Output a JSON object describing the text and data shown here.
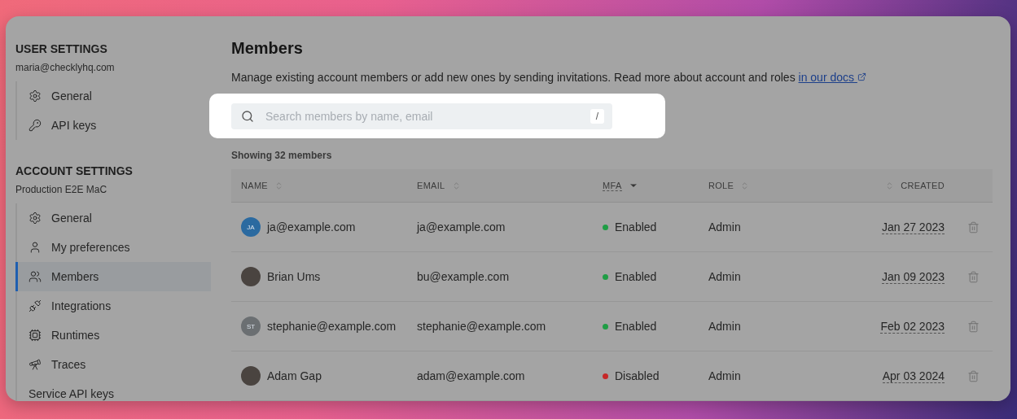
{
  "sidebar": {
    "sections": [
      {
        "title": "USER SETTINGS",
        "subtitle": "maria@checklyhq.com",
        "items": [
          {
            "label": "General",
            "kind": "gear",
            "selected": false
          },
          {
            "label": "API keys",
            "kind": "key",
            "selected": false
          }
        ]
      },
      {
        "title": "ACCOUNT SETTINGS",
        "subtitle": "Production E2E MaC",
        "items": [
          {
            "label": "General",
            "kind": "gear",
            "selected": false
          },
          {
            "label": "My preferences",
            "kind": "user",
            "selected": false
          },
          {
            "label": "Members",
            "kind": "users",
            "selected": true
          },
          {
            "label": "Integrations",
            "kind": "plug",
            "selected": false
          },
          {
            "label": "Runtimes",
            "kind": "chip",
            "selected": false
          },
          {
            "label": "Traces",
            "kind": "telescope",
            "selected": false
          },
          {
            "label": "Service API keys",
            "kind": "plain",
            "selected": false
          }
        ]
      }
    ]
  },
  "page": {
    "title": "Members",
    "description": "Manage existing account members or add new ones by sending invitations. Read more about account and roles ",
    "docs_link": "in our docs"
  },
  "search": {
    "placeholder": "Search members by name, email",
    "shortcut": "/"
  },
  "count": "Showing 32 members",
  "table": {
    "columns": [
      {
        "label": "NAME",
        "selected": false
      },
      {
        "label": "EMAIL",
        "selected": false
      },
      {
        "label": "MFA",
        "selected": true
      },
      {
        "label": "ROLE",
        "selected": false
      },
      {
        "label": "CREATED",
        "selected": false
      }
    ],
    "rows": [
      {
        "avatar": {
          "kind": "initials",
          "text": "JA",
          "color": "#2b6aa0"
        },
        "name": "ja@example.com",
        "email": "ja@example.com",
        "mfa": {
          "label": "Enabled",
          "color": "#1f9d45"
        },
        "role": "Admin",
        "created": "Jan 27 2023"
      },
      {
        "avatar": {
          "kind": "photo"
        },
        "name": "Brian Ums",
        "email": "bu@example.com",
        "mfa": {
          "label": "Enabled",
          "color": "#1f9d45"
        },
        "role": "Admin",
        "created": "Jan 09 2023"
      },
      {
        "avatar": {
          "kind": "initials",
          "text": "ST",
          "color": "#6b6f72"
        },
        "name": "stephanie@example.com",
        "email": "stephanie@example.com",
        "mfa": {
          "label": "Enabled",
          "color": "#1f9d45"
        },
        "role": "Admin",
        "created": "Feb 02 2023"
      },
      {
        "avatar": {
          "kind": "photo"
        },
        "name": "Adam Gap",
        "email": "adam@example.com",
        "mfa": {
          "label": "Disabled",
          "color": "#c62828"
        },
        "role": "Admin",
        "created": "Apr 03 2024"
      }
    ]
  }
}
